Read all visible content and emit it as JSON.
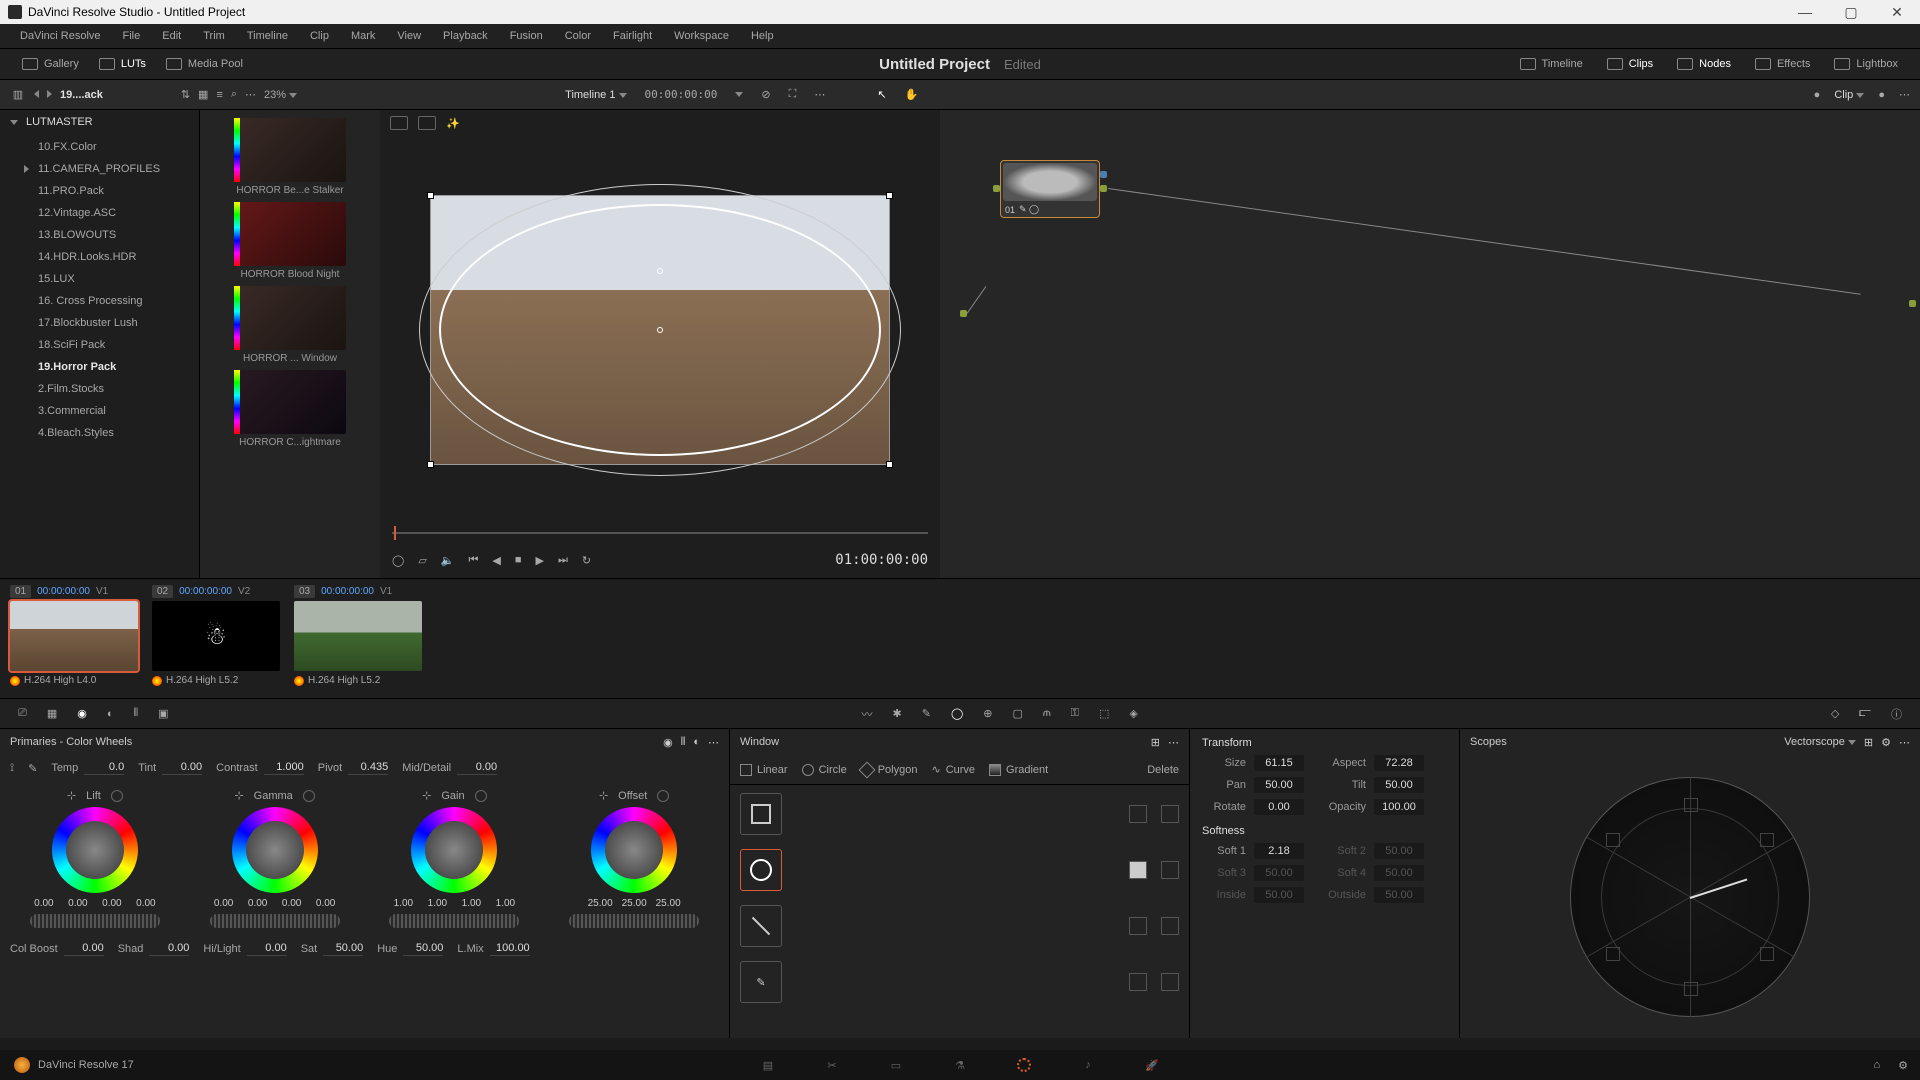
{
  "title": "DaVinci Resolve Studio - Untitled Project",
  "menu": [
    "DaVinci Resolve",
    "File",
    "Edit",
    "Trim",
    "Timeline",
    "Clip",
    "Mark",
    "View",
    "Playback",
    "Fusion",
    "Color",
    "Fairlight",
    "Workspace",
    "Help"
  ],
  "toolbar": {
    "gallery": "Gallery",
    "luts": "LUTs",
    "media_pool": "Media Pool",
    "timeline": "Timeline",
    "clips": "Clips",
    "nodes": "Nodes",
    "effects": "Effects",
    "lightbox": "Lightbox",
    "project": "Untitled Project",
    "status": "Edited"
  },
  "subtb": {
    "crumb": "19....ack",
    "zoom": "23%",
    "timeline_name": "Timeline 1",
    "tc": "00:00:00:00",
    "clip_label": "Clip"
  },
  "lut_header": "LUTMASTER",
  "lut_items": [
    {
      "label": "10.FX.Color"
    },
    {
      "label": "11.CAMERA_PROFILES",
      "children": true
    },
    {
      "label": "11.PRO.Pack"
    },
    {
      "label": "12.Vintage.ASC"
    },
    {
      "label": "13.BLOWOUTS"
    },
    {
      "label": "14.HDR.Looks.HDR"
    },
    {
      "label": "15.LUX"
    },
    {
      "label": "16. Cross Processing"
    },
    {
      "label": "17.Blockbuster Lush"
    },
    {
      "label": "18.SciFi Pack"
    },
    {
      "label": "19.Horror Pack",
      "selected": true
    },
    {
      "label": "2.Film.Stocks"
    },
    {
      "label": "3.Commercial"
    },
    {
      "label": "4.Bleach.Styles"
    }
  ],
  "thumbs": [
    {
      "label": "HORROR Be...e Stalker"
    },
    {
      "label": "HORROR Blood Night"
    },
    {
      "label": "HORROR ... Window"
    },
    {
      "label": "HORROR C...ightmare"
    }
  ],
  "viewer_tc": "01:00:00:00",
  "node": {
    "id": "01"
  },
  "clips": [
    {
      "num": "01",
      "tc": "00:00:00:00",
      "track": "V1",
      "codec": "H.264 High L4.0"
    },
    {
      "num": "02",
      "tc": "00:00:00:00",
      "track": "V2",
      "codec": "H.264 High L5.2"
    },
    {
      "num": "03",
      "tc": "00:00:00:00",
      "track": "V1",
      "codec": "H.264 High L5.2"
    }
  ],
  "primaries": {
    "title": "Primaries - Color Wheels",
    "temp_l": "Temp",
    "temp": "0.0",
    "tint_l": "Tint",
    "tint": "0.00",
    "contrast_l": "Contrast",
    "contrast": "1.000",
    "pivot_l": "Pivot",
    "pivot": "0.435",
    "md_l": "Mid/Detail",
    "md": "0.00",
    "wheels": {
      "lift": {
        "t": "Lift",
        "v": [
          "0.00",
          "0.00",
          "0.00",
          "0.00"
        ]
      },
      "gamma": {
        "t": "Gamma",
        "v": [
          "0.00",
          "0.00",
          "0.00",
          "0.00"
        ]
      },
      "gain": {
        "t": "Gain",
        "v": [
          "1.00",
          "1.00",
          "1.00",
          "1.00"
        ]
      },
      "offset": {
        "t": "Offset",
        "v": [
          "25.00",
          "25.00",
          "25.00"
        ]
      }
    },
    "row2": {
      "colboost_l": "Col Boost",
      "colboost": "0.00",
      "shad_l": "Shad",
      "shad": "0.00",
      "hilight_l": "Hi/Light",
      "hilight": "0.00",
      "sat_l": "Sat",
      "sat": "50.00",
      "hue_l": "Hue",
      "hue": "50.00",
      "lmix_l": "L.Mix",
      "lmix": "100.00"
    }
  },
  "window": {
    "title": "Window",
    "linear": "Linear",
    "circle": "Circle",
    "polygon": "Polygon",
    "curve": "Curve",
    "gradient": "Gradient",
    "delete": "Delete",
    "transform": "Transform",
    "softness": "Softness",
    "size_l": "Size",
    "size": "61.15",
    "aspect_l": "Aspect",
    "aspect": "72.28",
    "pan_l": "Pan",
    "pan": "50.00",
    "tilt_l": "Tilt",
    "tilt": "50.00",
    "rotate_l": "Rotate",
    "rotate": "0.00",
    "opacity_l": "Opacity",
    "opacity": "100.00",
    "soft1_l": "Soft 1",
    "soft1": "2.18",
    "soft2_l": "Soft 2",
    "soft2": "50.00",
    "soft3_l": "Soft 3",
    "soft3": "50.00",
    "soft4_l": "Soft 4",
    "soft4": "50.00",
    "inside_l": "Inside",
    "inside": "50.00",
    "outside_l": "Outside",
    "outside": "50.00"
  },
  "scopes": {
    "title": "Scopes",
    "mode": "Vectorscope"
  },
  "footer": {
    "app": "DaVinci Resolve 17"
  }
}
